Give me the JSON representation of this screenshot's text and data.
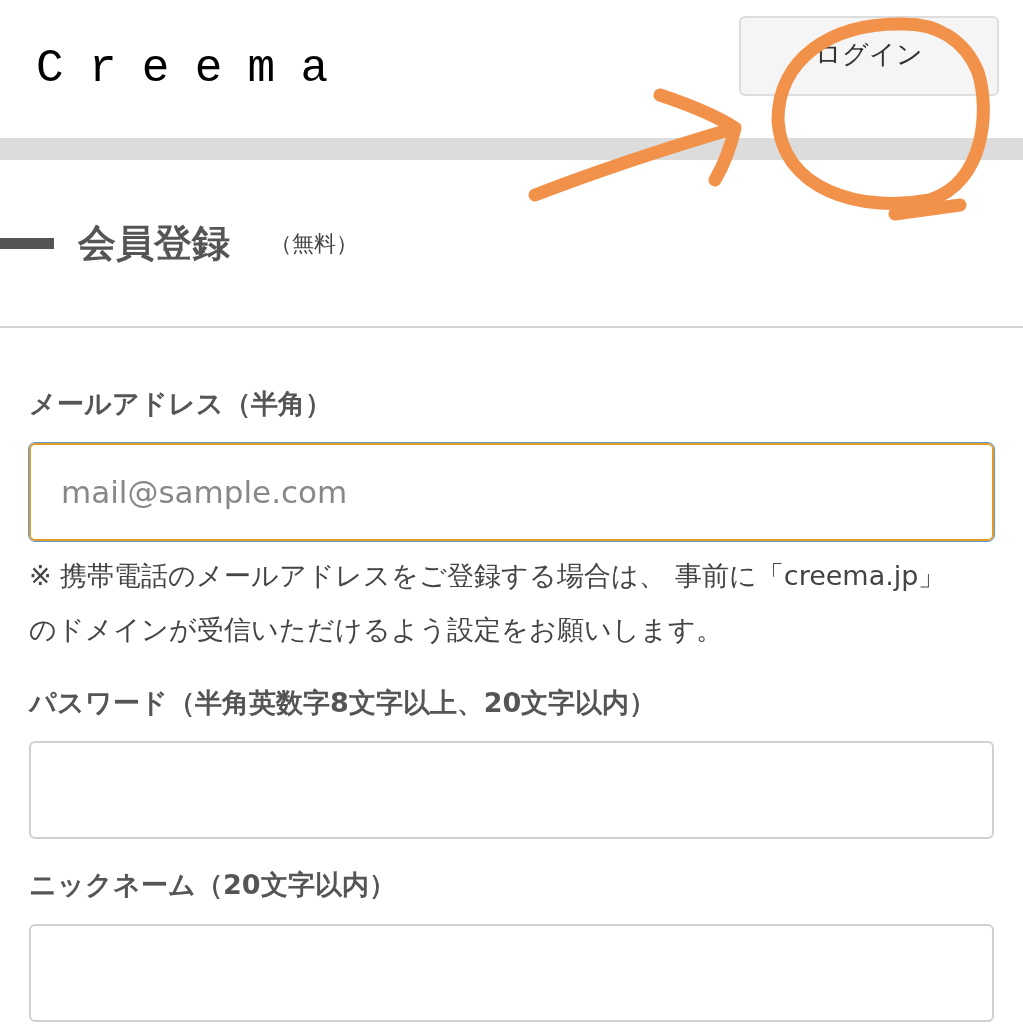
{
  "header": {
    "logo": "Creema",
    "login_button": "ログイン"
  },
  "section": {
    "title": "会員登録",
    "note": "（無料）"
  },
  "form": {
    "fields": [
      {
        "label": "メールアドレス（半角）",
        "placeholder": "mail@sample.com",
        "focused": true,
        "help": "※ 携帯電話のメールアドレスをご登録する場合は、 事前に「creema.jp」のドメインが受信いただけるよう設定をお願いします。"
      },
      {
        "label": "パスワード（半角英数字8文字以上、20文字以内）",
        "focused": false
      },
      {
        "label": "ニックネーム（20文字以内）",
        "focused": false
      }
    ]
  }
}
